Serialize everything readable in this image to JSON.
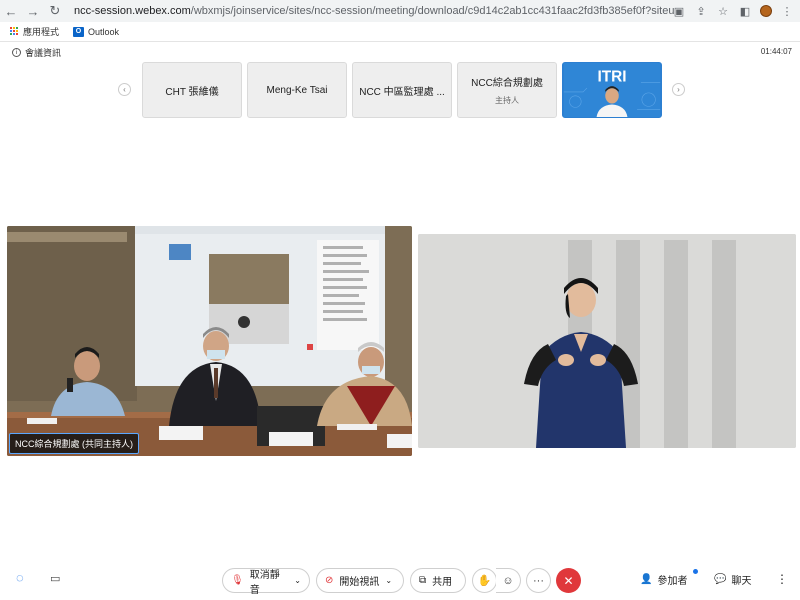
{
  "browser": {
    "url_host": "ncc-session.webex.com",
    "url_path": "/wbxmjs/joinservice/sites/ncc-session/meeting/download/c9d14c2ab1cc431faac2fd3fb385ef0f?siteurl=ncc-session",
    "bookmarks": [
      {
        "label": "應用程式",
        "icon": "apps-grid-icon"
      },
      {
        "label": "Outlook",
        "icon": "outlook-icon"
      }
    ]
  },
  "meeting": {
    "info_label": "會議資訊",
    "timer": "01:44:07"
  },
  "participants": [
    {
      "name": "CHT 張維儀",
      "role": ""
    },
    {
      "name": "Meng-Ke Tsai",
      "role": ""
    },
    {
      "name": "NCC 中區監理處 ...",
      "role": ""
    },
    {
      "name": "NCC綜合規劃處",
      "role": "主持人"
    },
    {
      "name": "ITRI",
      "role": "",
      "video": true
    }
  ],
  "main_video": {
    "name_tag": "NCC綜合規劃處 (共同主持人)"
  },
  "toolbar": {
    "mute_label": "取消靜音",
    "video_label": "開始視訊",
    "share_label": "共用",
    "more_label": "···",
    "participants_label": "參加者",
    "chat_label": "聊天"
  },
  "colors": {
    "accent": "#1a73e8",
    "end_call": "#e0383b",
    "mute_icon": "#e0383b"
  }
}
